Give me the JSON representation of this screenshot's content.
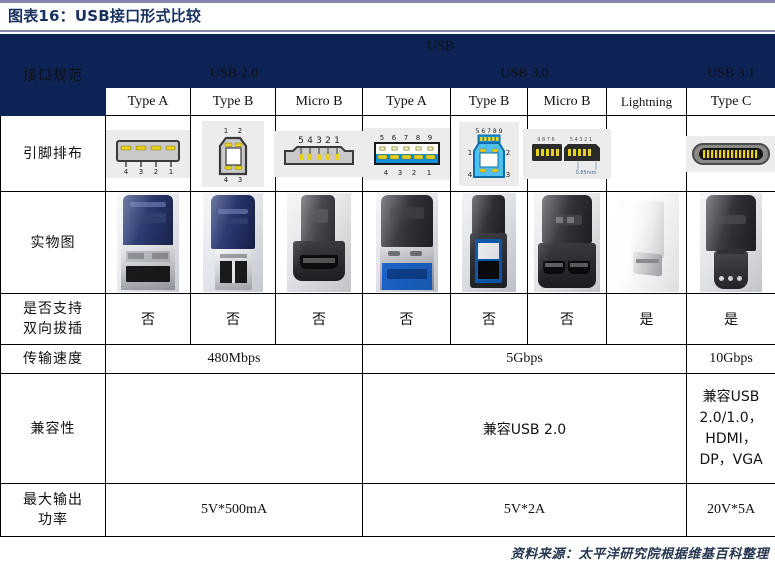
{
  "title": "图表16：USB接口形式比较",
  "table": {
    "spec_label": "接口规范",
    "group_all": "USB",
    "groups": [
      {
        "label": "USB 2.0",
        "span": 3
      },
      {
        "label": "USB 3.0",
        "span": 4
      },
      {
        "label": "USB 3.1",
        "span": 1
      }
    ],
    "types": [
      "Type A",
      "Type B",
      "Micro B",
      "Type A",
      "Type B",
      "Micro B",
      "Lightning",
      "Type C"
    ],
    "rows": {
      "pin_label": "引脚排布",
      "photo_label": "实物图",
      "bidi_label": "是否支持\n双向拔插",
      "bidi_label_line1": "是否支持",
      "bidi_label_line2": "双向拔插",
      "bidi_values": [
        "否",
        "否",
        "否",
        "否",
        "否",
        "否",
        "是",
        "是"
      ],
      "speed_label": "传输速度",
      "speed_values": [
        {
          "text": "480Mbps",
          "span": 3
        },
        {
          "text": "5Gbps",
          "span": 4
        },
        {
          "text": "10Gbps",
          "span": 1
        }
      ],
      "compat_label": "兼容性",
      "compat_values": [
        {
          "text": "",
          "span": 3
        },
        {
          "text": "兼容USB 2.0",
          "span": 4
        },
        {
          "lines": [
            "兼容USB",
            "2.0/1.0，",
            "HDMI，",
            "DP，VGA"
          ],
          "span": 1
        }
      ],
      "power_label_line1": "最大输出",
      "power_label_line2": "功率",
      "power_values": [
        {
          "text": "5V*500mA",
          "span": 3
        },
        {
          "text": "5V*2A",
          "span": 4
        },
        {
          "text": "20V*5A",
          "span": 1
        }
      ]
    },
    "pin_diagrams": [
      {
        "name": "usb2-type-a-pinout",
        "top_numbers": [],
        "bottom_numbers": [
          "4",
          "3",
          "2",
          "1"
        ]
      },
      {
        "name": "usb2-type-b-pinout",
        "top_numbers": [
          "1",
          "2"
        ],
        "bottom_numbers": [
          "4",
          "3"
        ]
      },
      {
        "name": "usb2-micro-b-pinout",
        "top_numbers": [
          "5",
          "4",
          "3",
          "2",
          "1"
        ],
        "bottom_numbers": []
      },
      {
        "name": "usb3-type-a-pinout",
        "top_numbers": [
          "5",
          "6",
          "7",
          "8",
          "9"
        ],
        "bottom_numbers": [
          "4",
          "3",
          "2",
          "1"
        ]
      },
      {
        "name": "usb3-type-b-pinout",
        "top_numbers": [
          "5",
          "6",
          "7",
          "8",
          "9"
        ],
        "bottom_numbers": [
          "1",
          "2",
          "4",
          "3"
        ]
      },
      {
        "name": "usb3-micro-b-pinout",
        "top_numbers": [
          "0.85mm"
        ],
        "bottom_numbers": []
      },
      {
        "name": "lightning-pinout-empty",
        "top_numbers": [],
        "bottom_numbers": []
      },
      {
        "name": "usb-type-c-pinout",
        "top_numbers": [],
        "bottom_numbers": []
      }
    ],
    "photos": [
      "usb2-type-a-photo",
      "usb2-type-b-photo",
      "usb2-micro-b-photo",
      "usb3-type-a-photo",
      "usb3-type-b-photo",
      "usb3-micro-b-photo",
      "lightning-photo",
      "usb-type-c-photo"
    ]
  },
  "source": "资料来源：太平洋研究院根据维基百科整理",
  "colors": {
    "header_navy": "#0d2255",
    "title_text": "#17305e",
    "rule": "#8487aa",
    "usb3_blue": "#0e8fd8",
    "pin_gold": "#e8d11a"
  }
}
